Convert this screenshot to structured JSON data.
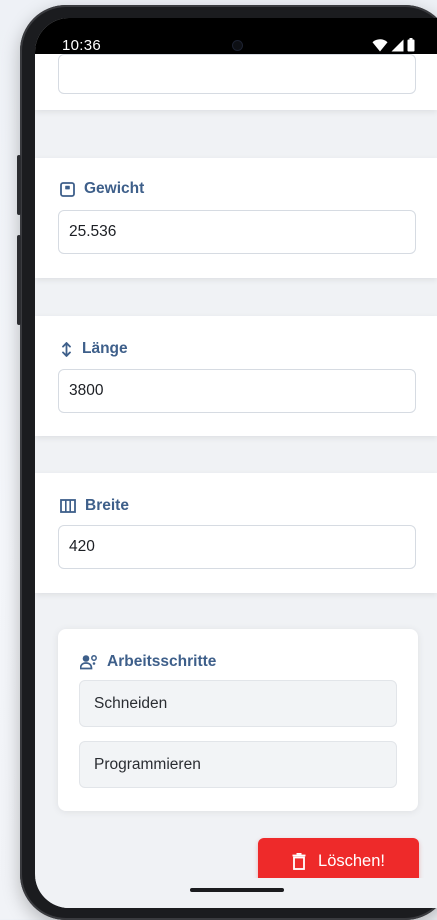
{
  "status_bar": {
    "time": "10:36"
  },
  "fields": {
    "gewicht": {
      "label": "Gewicht",
      "value": "25.536",
      "icon": "weight-icon"
    },
    "laenge": {
      "label": "Länge",
      "value": "3800",
      "icon": "arrow-up-down-icon"
    },
    "breite": {
      "label": "Breite",
      "value": "420",
      "icon": "columns-icon"
    }
  },
  "arbeitsschritte": {
    "label": "Arbeitsschritte",
    "icon": "users-gear-icon",
    "items": [
      {
        "label": "Schneiden"
      },
      {
        "label": "Programmieren"
      }
    ]
  },
  "delete_button": {
    "label": "Löschen!",
    "icon": "trash-icon",
    "color": "#ee2a2a"
  },
  "colors": {
    "label": "#3e5f8a",
    "background": "#f0f2f5",
    "card": "#ffffff"
  }
}
